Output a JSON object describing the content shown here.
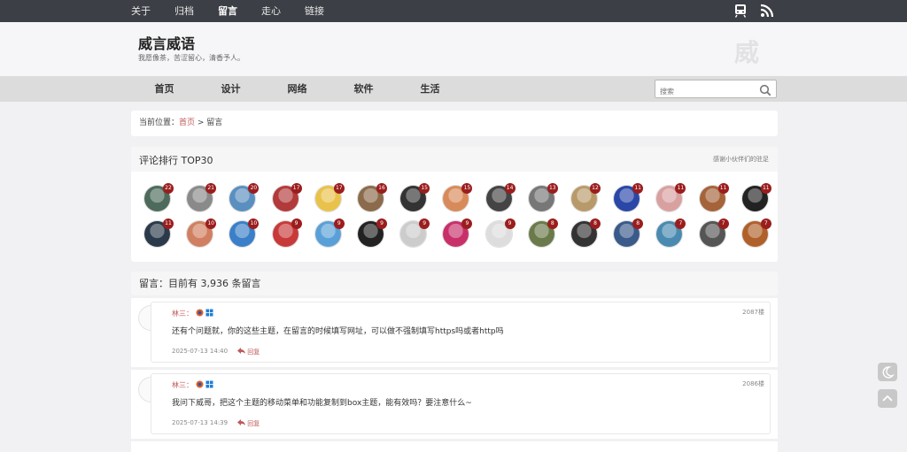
{
  "topnav": {
    "items": [
      "关于",
      "归档",
      "留言",
      "走心",
      "链接"
    ],
    "active": "留言"
  },
  "header": {
    "title": "威言威语",
    "desc": "我愿像茶，苦涩留心，清香予人。",
    "logo_char": "威"
  },
  "nav": {
    "items": [
      "首页",
      "设计",
      "网络",
      "软件",
      "生活"
    ]
  },
  "search": {
    "placeholder": "搜索"
  },
  "breadcrumb": {
    "label": "当前位置：",
    "home": "首页",
    "sep": " > ",
    "current": "留言"
  },
  "rank": {
    "title": "评论排行 TOP30",
    "note": "感谢小伙伴们的驻足",
    "users": [
      {
        "count": "22",
        "color": "#4d6b5c"
      },
      {
        "count": "21",
        "color": "#8a8a8a"
      },
      {
        "count": "20",
        "color": "#5a8fc0"
      },
      {
        "count": "17",
        "color": "#b23a3a"
      },
      {
        "count": "17",
        "color": "#e8c24a"
      },
      {
        "count": "16",
        "color": "#8b6b4b"
      },
      {
        "count": "15",
        "color": "#333333"
      },
      {
        "count": "15",
        "color": "#d88a5a"
      },
      {
        "count": "14",
        "color": "#444444"
      },
      {
        "count": "13",
        "color": "#777777"
      },
      {
        "count": "12",
        "color": "#b89a6a"
      },
      {
        "count": "11",
        "color": "#2a47a8"
      },
      {
        "count": "11",
        "color": "#d9a0a0"
      },
      {
        "count": "11",
        "color": "#a5633a"
      },
      {
        "count": "11",
        "color": "#222222"
      },
      {
        "count": "11",
        "color": "#2b3a4a"
      },
      {
        "count": "10",
        "color": "#d08060"
      },
      {
        "count": "10",
        "color": "#3a7fc8"
      },
      {
        "count": "9",
        "color": "#c83a3a"
      },
      {
        "count": "9",
        "color": "#5aa0d8"
      },
      {
        "count": "9",
        "color": "#222222"
      },
      {
        "count": "9",
        "color": "#cccccc"
      },
      {
        "count": "9",
        "color": "#c8306a"
      },
      {
        "count": "9",
        "color": "#dddddd"
      },
      {
        "count": "8",
        "color": "#6a7a4a"
      },
      {
        "count": "8",
        "color": "#333333"
      },
      {
        "count": "8",
        "color": "#3a5a8a"
      },
      {
        "count": "7",
        "color": "#4a8ab0"
      },
      {
        "count": "7",
        "color": "#555555"
      },
      {
        "count": "7",
        "color": "#b0602a"
      }
    ]
  },
  "comments_header": "留言：目前有 3,936 条留言",
  "comments": [
    {
      "author": "林三：",
      "floor": "2087楼",
      "text": "还有个问题就，你的这些主题，在留言的时候填写网址，可以做不强制填写https吗或者http吗",
      "date": "2025-07-13 14:40",
      "reply": "回复"
    },
    {
      "author": "林三：",
      "floor": "2086楼",
      "text": "我问下威哥，把这个主题的移动菜单和功能复制到box主题，能有效吗？要注意什么~",
      "date": "2025-07-13 14:39",
      "reply": "回复"
    }
  ]
}
